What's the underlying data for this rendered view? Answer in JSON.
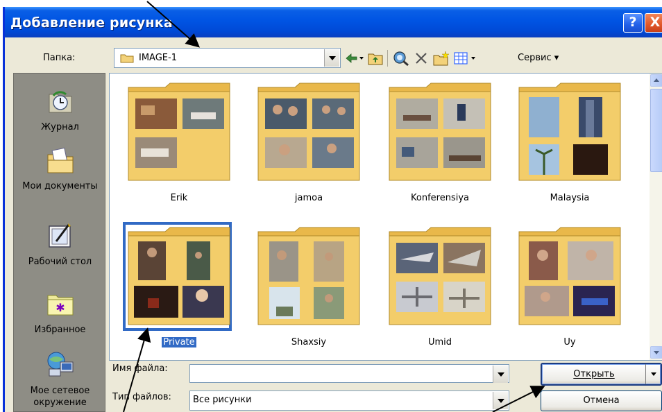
{
  "window": {
    "title": "Добавление рисунка",
    "help_label": "?",
    "close_label": "X"
  },
  "toolbar": {
    "folder_label": "Папка:",
    "folder_value": "IMAGE-1",
    "service_label": "Сервис ▾"
  },
  "places": [
    {
      "label": "Журнал",
      "icon": "history-icon"
    },
    {
      "label": "Мои документы",
      "icon": "my-documents-icon"
    },
    {
      "label": "Рабочий стол",
      "icon": "desktop-icon"
    },
    {
      "label": "Избранное",
      "icon": "favorites-icon"
    },
    {
      "label": "Мое сетевое окружение",
      "icon": "network-icon"
    }
  ],
  "files": [
    {
      "name": "Erik",
      "selected": false
    },
    {
      "name": "jamoa",
      "selected": false
    },
    {
      "name": "Konferensiya",
      "selected": false
    },
    {
      "name": "Malaysia",
      "selected": false
    },
    {
      "name": "Private",
      "selected": true
    },
    {
      "name": "Shaxsiy",
      "selected": false
    },
    {
      "name": "Umid",
      "selected": false
    },
    {
      "name": "Uy",
      "selected": false
    }
  ],
  "bottom": {
    "filename_label": "Имя файла:",
    "filename_value": "",
    "filetype_label": "Тип файлов:",
    "filetype_value": "Все рисунки",
    "open_label": "Открыть",
    "cancel_label": "Отмена"
  },
  "colors": {
    "titlebar": "#0054e3",
    "selection": "#316ac5",
    "folder": "#f3c85a"
  }
}
